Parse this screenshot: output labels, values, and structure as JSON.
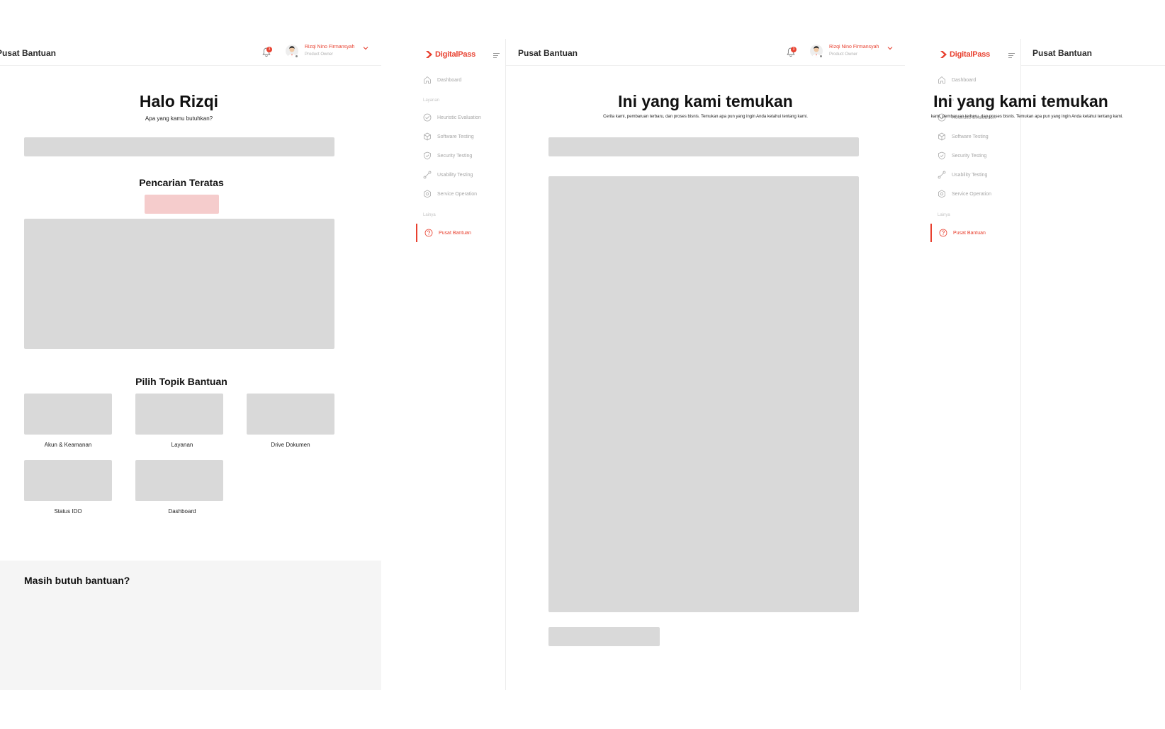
{
  "brand": {
    "name": "DigitalPass",
    "color": "#e8402f"
  },
  "user": {
    "name": "Rizqi Nino Firmansyah",
    "role": "Product Owner",
    "notification_count": "3"
  },
  "page_title": "Pusat Bantuan",
  "sidebar": {
    "dashboard": "Dashboard",
    "section_services": "Layanan",
    "items": [
      "Heuristic Evaluation",
      "Software Testing",
      "Security Testing",
      "Usability Testing",
      "Service Operation"
    ],
    "section_other": "Lainya",
    "active_item": "Pusat Bantuan"
  },
  "help_home": {
    "greeting": "Halo Rizqi",
    "prompt": "Apa yang kamu butuhkan?",
    "top_search_title": "Pencarian Teratas",
    "topics_title": "Pilih Topik Bantuan",
    "topics": [
      "Akun & Keamanan",
      "Layanan",
      "Drive Dokumen",
      "Status IDO",
      "Dashboard"
    ],
    "footer_title": "Masih butuh bantuan?"
  },
  "search_results": {
    "title": "Ini yang kami temukan",
    "description": "Cerita kami, pembaruan terbaru, dan proses bisnis. Temukan apa pun yang ingin Anda ketahui tentang kami."
  },
  "colors": {
    "accent": "#e8402f",
    "placeholder": "#d9d9d9",
    "accent_soft": "#f5cccc",
    "footer_bg": "#f5f5f5"
  }
}
